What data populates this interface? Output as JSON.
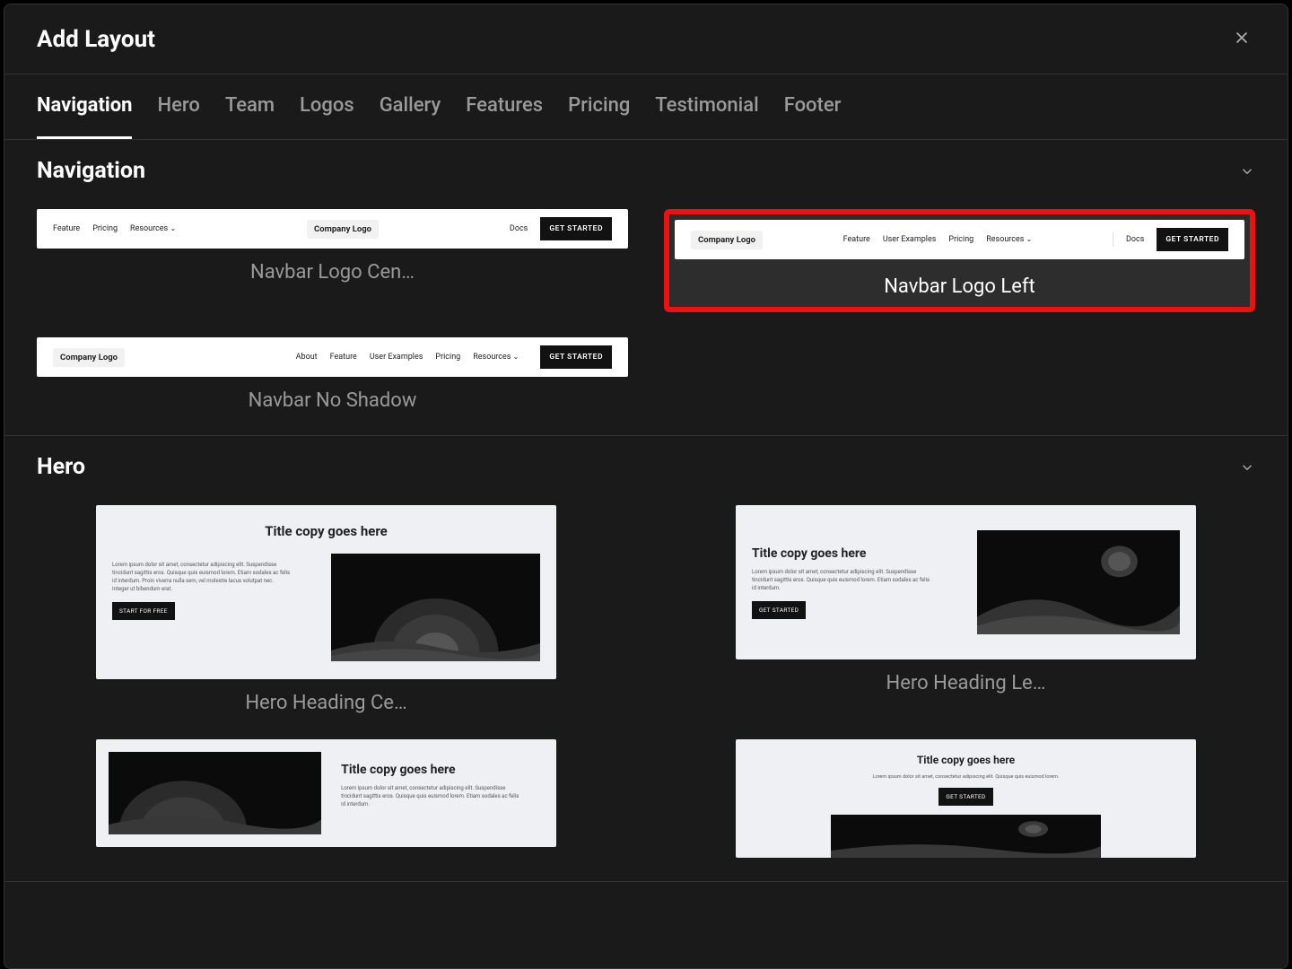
{
  "modal": {
    "title": "Add Layout"
  },
  "tabs": [
    "Navigation",
    "Hero",
    "Team",
    "Logos",
    "Gallery",
    "Features",
    "Pricing",
    "Testimonial",
    "Footer"
  ],
  "active_tab": "Navigation",
  "sections": {
    "navigation": {
      "title": "Navigation",
      "cards": [
        {
          "label": "Navbar Logo Cen…",
          "kind": "logo-center",
          "logo": "Company Logo",
          "left_links": [
            "Feature",
            "Pricing",
            "Resources"
          ],
          "right_links": [
            "Docs"
          ],
          "cta": "GET STARTED"
        },
        {
          "label": "Navbar Logo Left",
          "kind": "logo-left",
          "highlighted": true,
          "logo": "Company Logo",
          "links": [
            "Feature",
            "User Examples",
            "Pricing",
            "Resources"
          ],
          "right_links": [
            "Docs"
          ],
          "cta": "GET STARTED"
        },
        {
          "label": "Navbar No Shadow",
          "kind": "no-shadow",
          "logo": "Company Logo",
          "links": [
            "About",
            "Feature",
            "User Examples",
            "Pricing",
            "Resources"
          ],
          "cta": "GET STARTED"
        }
      ]
    },
    "hero": {
      "title": "Hero",
      "cards": [
        {
          "label": "Hero Heading Ce…",
          "title": "Title copy goes here",
          "lorem": "Lorem ipsum dolor sit amet, consectetur adipiscing elit. Suspendisse tincidunt sagittis eros. Quisque quis euismod lorem. Etiam sodales ac felis id interdum. Proin viverra nulla sem, vel molestie lacus volutpat nec. Integer ut bibendum erat.",
          "cta": "START FOR FREE"
        },
        {
          "label": "Hero Heading Le…",
          "title": "Title copy goes here",
          "lorem": "Lorem ipsum dolor sit amet, consectetur adipiscing elit. Suspendisse tincidunt sagittis eros. Quisque quis euismod lorem. Etiam sodales ac felis id interdum.",
          "cta": "GET STARTED"
        },
        {
          "label": "",
          "title": "Title copy goes here",
          "lorem": "Lorem ipsum dolor sit amet, consectetur adipiscing elit. Suspendisse tincidunt sagittis eros. Quisque quis euismod lorem. Etiam sodales ac felis id interdum.",
          "cta": ""
        },
        {
          "label": "",
          "title": "Title copy goes here",
          "lorem": "Lorem ipsum dolor sit amet, consectetur adipiscing elit. Quisque quis euismod lorem.",
          "cta": "GET STARTED"
        }
      ]
    }
  }
}
